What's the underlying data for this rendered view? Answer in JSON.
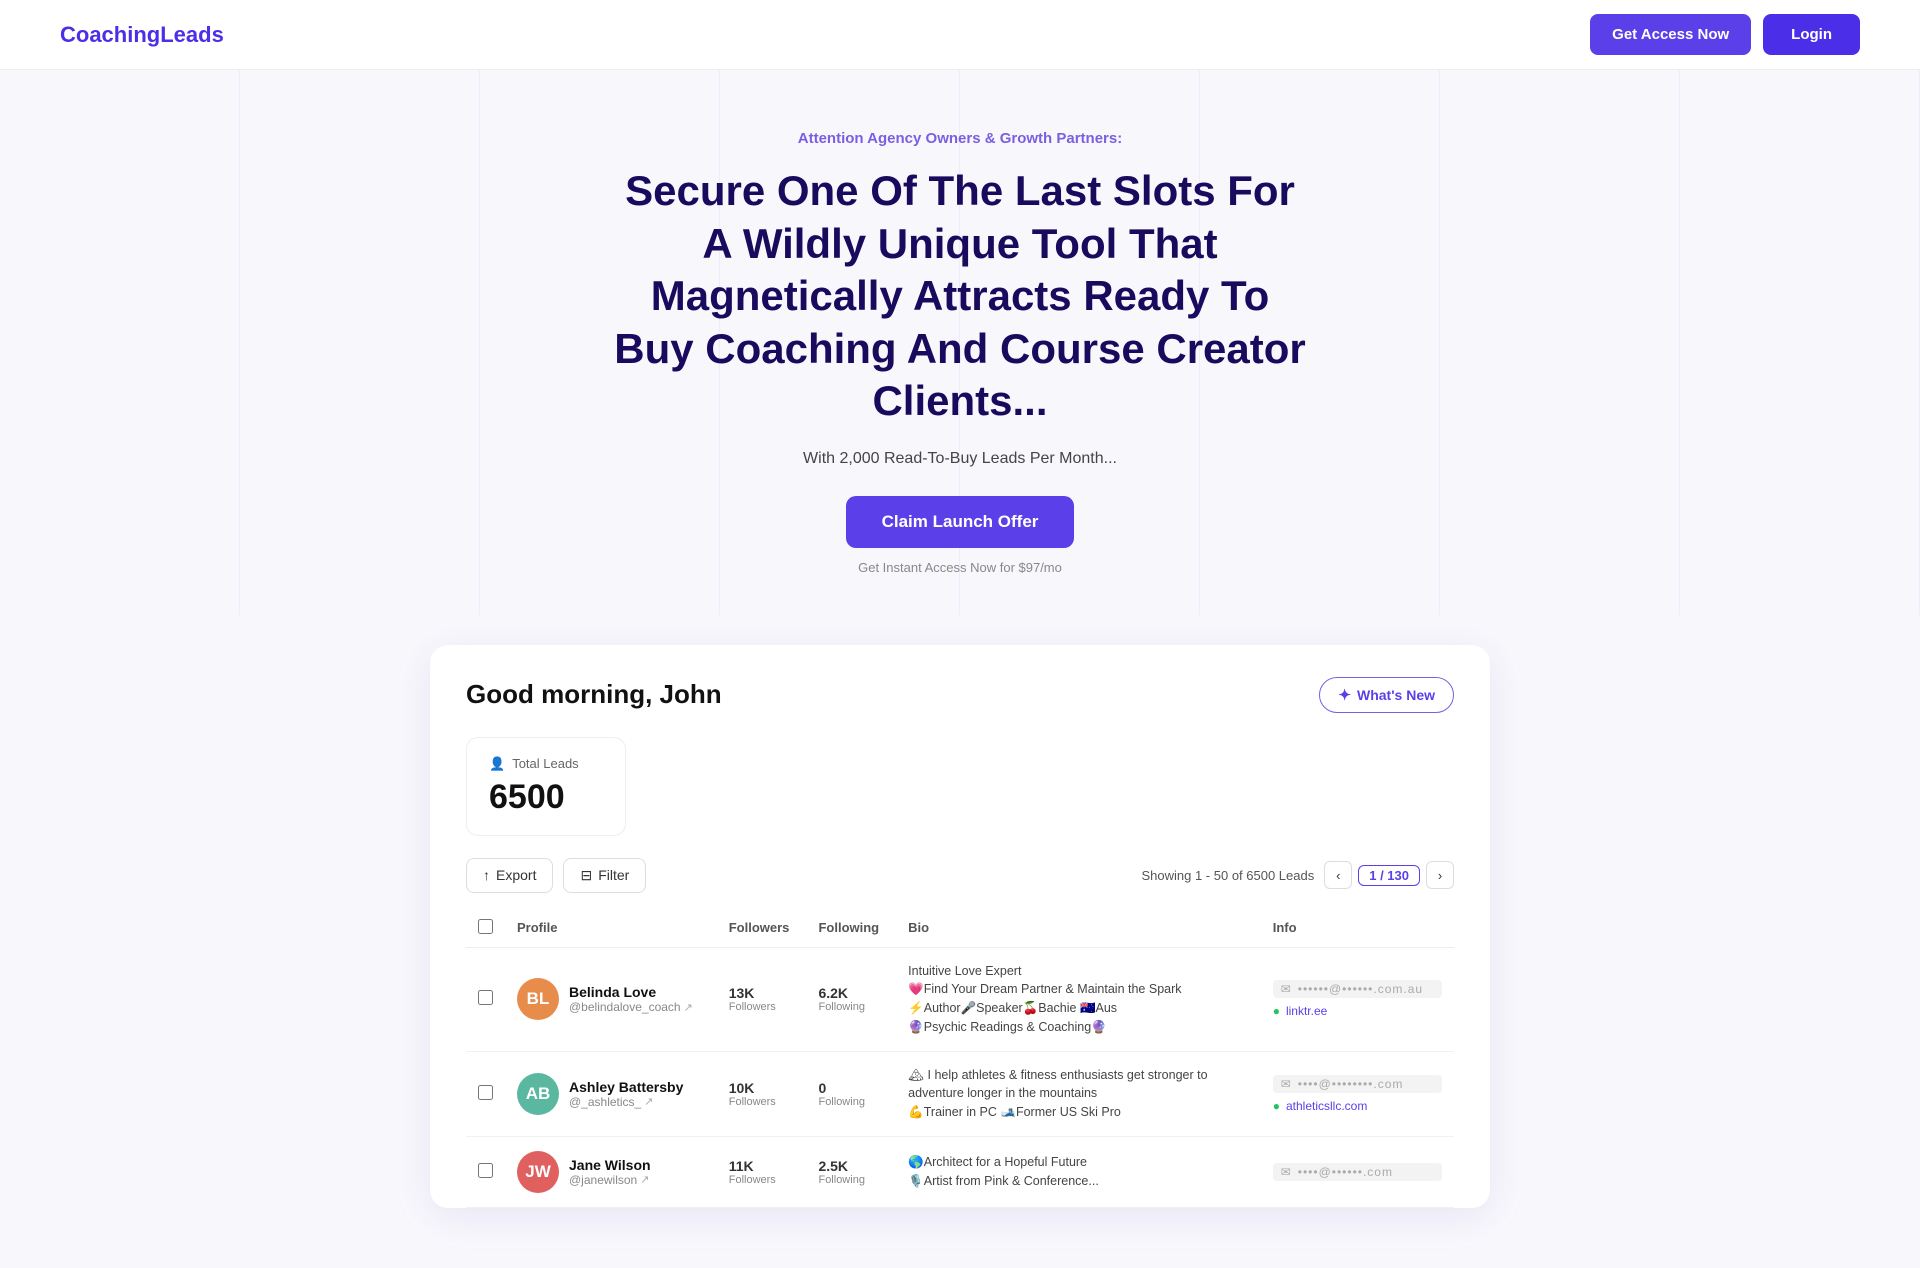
{
  "navbar": {
    "logo": "CoachingLeads",
    "get_access_label": "Get Access Now",
    "login_label": "Login"
  },
  "hero": {
    "label": "Attention Agency Owners & Growth Partners:",
    "title": "Secure One Of The Last Slots For A Wildly Unique Tool That Magnetically Attracts Ready To Buy Coaching And Course Creator Clients...",
    "subtitle": "With 2,000 Read-To-Buy Leads Per Month...",
    "cta_label": "Claim Launch Offer",
    "fine_print": "Get Instant Access Now for $97/mo"
  },
  "dashboard": {
    "greeting": "Good morning, John",
    "whats_new_label": "What's New",
    "total_leads_label": "Total Leads",
    "total_leads_count": "6500",
    "export_label": "Export",
    "filter_label": "Filter",
    "showing_text": "Showing 1 - 50 of 6500 Leads",
    "page_current": "1 / 130",
    "columns": {
      "profile": "Profile",
      "followers": "Followers",
      "following": "Following",
      "bio": "Bio",
      "info": "Info"
    },
    "rows": [
      {
        "id": 1,
        "name": "Belinda Love",
        "handle": "@belindalove_coach",
        "avatar_color": "#e88c4c",
        "avatar_initials": "BL",
        "followers_num": "13K",
        "followers_label": "Followers",
        "following_num": "6.2K",
        "following_label": "Following",
        "bio": "Intuitive Love Expert\n💗Find Your Dream Partner & Maintain the Spark\n⚡Author🎤Speaker🍒Bachie 🇦🇺Aus\n🔮Psychic Readings & Coaching🔮",
        "email_blurred": "••••••@••••••.com.au",
        "link_icon": "green-globe",
        "link_text": "linktr.ee",
        "link_href": "linktr.ee"
      },
      {
        "id": 2,
        "name": "Ashley Battersby",
        "handle": "@_ashletics_",
        "avatar_color": "#5ab8a0",
        "avatar_initials": "AB",
        "followers_num": "10K",
        "followers_label": "Followers",
        "following_num": "0",
        "following_label": "Following",
        "bio": "🏔 I help athletes & fitness enthusiasts get stronger to adventure longer in the mountains\n💪Trainer in PC 🎿Former US Ski Pro",
        "email_blurred": "••••@••••••••.com",
        "link_icon": "link",
        "link_text": "athleticsllc.com",
        "link_href": "athleticsllc.com"
      },
      {
        "id": 3,
        "name": "Jane Wilson",
        "handle": "@janewilson",
        "avatar_color": "#e06060",
        "avatar_initials": "JW",
        "followers_num": "11K",
        "followers_label": "Followers",
        "following_num": "2.5K",
        "following_label": "Following",
        "bio": "🌎Architect for a Hopeful Future\n🎙️Artist from Pink & Conference...",
        "email_blurred": "••••@••••••.com",
        "link_icon": "link",
        "link_text": "",
        "link_href": ""
      }
    ]
  },
  "icons": {
    "person": "👤",
    "export": "↑",
    "filter": "⊟",
    "chevron_left": "‹",
    "chevron_right": "›",
    "star": "✦",
    "mail": "✉",
    "link_chain": "🔗",
    "green_dot": "🟢",
    "verified": "✓"
  }
}
